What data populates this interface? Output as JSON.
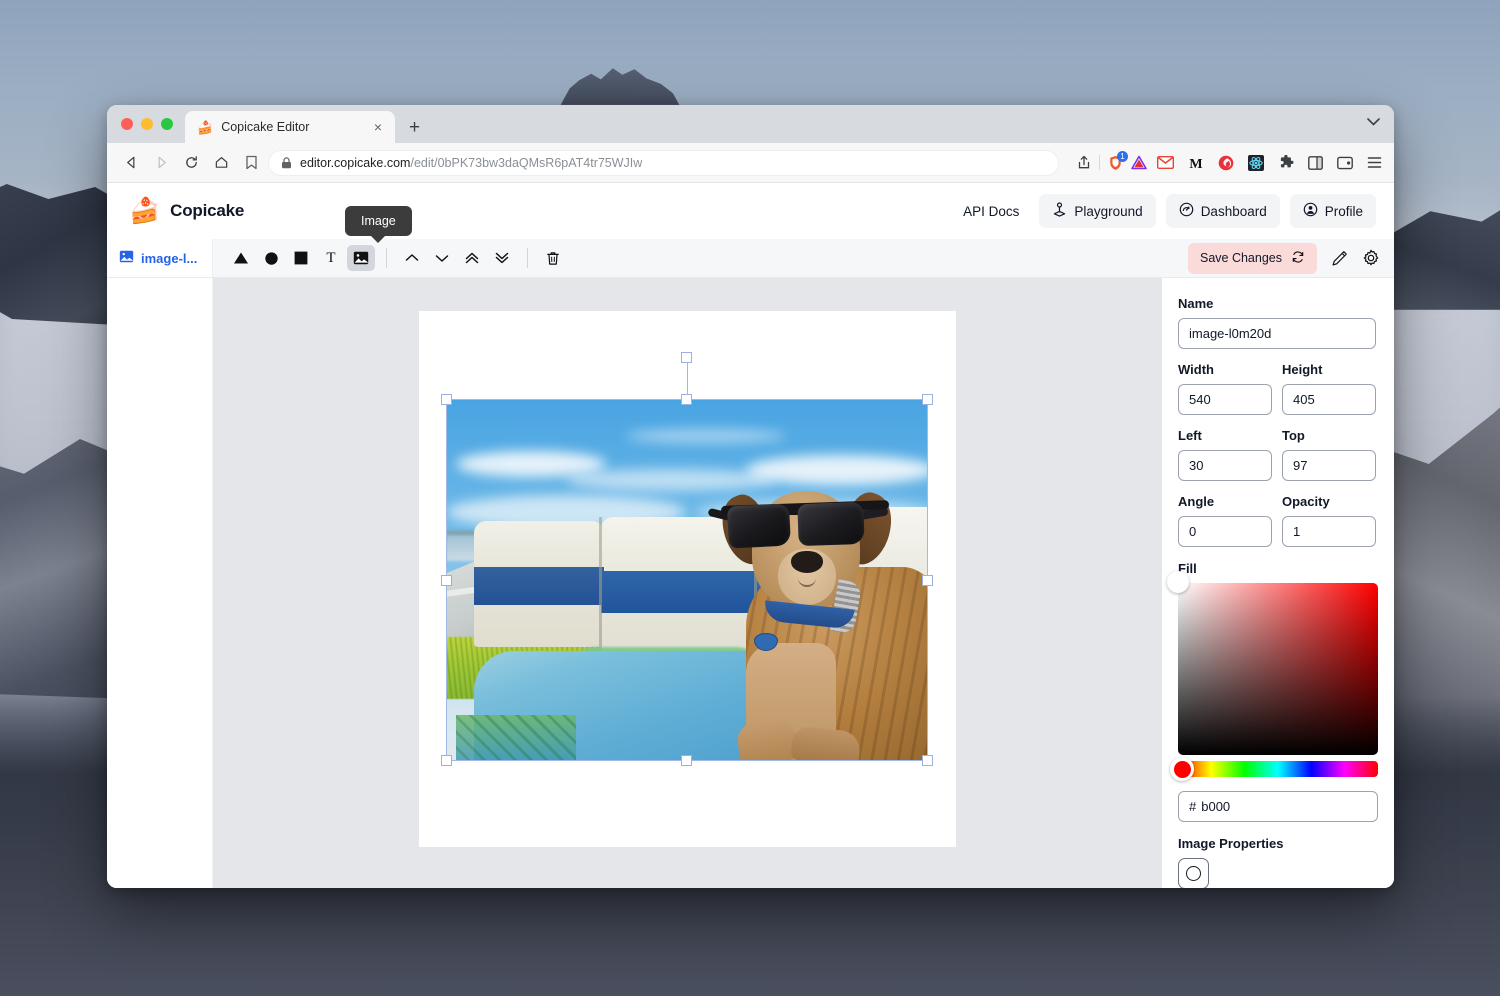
{
  "browser": {
    "tab": {
      "title": "Copicake Editor",
      "favicon": "cake-icon",
      "close": "×"
    },
    "new_tab_label": "+",
    "tab_list_chevron": "⌄",
    "url_domain": "editor.copicake.com",
    "url_path": "/edit/0bPK73bw3daQMsR6pAT4tr75WJIw",
    "shield_badge": "1",
    "icons": {
      "back": "back-icon",
      "forward": "forward-icon",
      "reload": "reload-icon",
      "home": "home-icon",
      "bookmark": "bookmark-icon",
      "lock": "lock-icon",
      "share": "share-icon",
      "shield": "brave-shield-icon",
      "vercel": "vercel-icon",
      "gmail": "gmail-icon",
      "medium": "medium-icon",
      "flame": "flame-icon",
      "react": "react-icon",
      "puzzle": "extensions-icon",
      "sidebar": "sidebar-icon",
      "wallet": "wallet-icon",
      "menu": "menu-icon"
    }
  },
  "app": {
    "brand": "Copicake",
    "brand_logo": "cake-slice-icon",
    "nav": [
      {
        "label": "API Docs",
        "icon": ""
      },
      {
        "label": "Playground",
        "icon": "joystick-icon"
      },
      {
        "label": "Dashboard",
        "icon": "gauge-icon"
      },
      {
        "label": "Profile",
        "icon": "person-icon"
      }
    ],
    "tooltip": "Image",
    "layer": {
      "label": "image-l...",
      "icon": "image-icon"
    },
    "toolbar": {
      "tools": [
        {
          "name": "triangle-tool",
          "glyph": "▲",
          "active": false
        },
        {
          "name": "circle-tool",
          "glyph": "●",
          "active": false
        },
        {
          "name": "square-tool",
          "glyph": "■",
          "active": false
        },
        {
          "name": "text-tool",
          "glyph": "T",
          "active": false
        },
        {
          "name": "image-tool",
          "glyph": "image",
          "active": true
        }
      ],
      "arrange": [
        {
          "name": "bring-forward",
          "glyph": "⌃"
        },
        {
          "name": "send-backward",
          "glyph": "⌄"
        },
        {
          "name": "bring-to-front",
          "glyph": "«"
        },
        {
          "name": "send-to-back",
          "glyph": "»"
        }
      ],
      "delete": "trash-icon",
      "save_label": "Save Changes",
      "save_icon": "sync-icon",
      "pen_icon": "pen-icon",
      "settings_icon": "gear-icon"
    },
    "properties": {
      "name_label": "Name",
      "name_value": "image-l0m20d",
      "width_label": "Width",
      "width_value": "540",
      "height_label": "Height",
      "height_value": "405",
      "left_label": "Left",
      "left_value": "30",
      "top_label": "Top",
      "top_value": "97",
      "angle_label": "Angle",
      "angle_value": "0",
      "opacity_label": "Opacity",
      "opacity_value": "1",
      "fill_label": "Fill",
      "hex_prefix": "#",
      "hex_value": "b000",
      "image_properties_label": "Image Properties",
      "image_properties_button": "circle-crop-icon"
    },
    "colors": {
      "save_bg": "#fbdada",
      "layer_text": "#2563eb",
      "picker_hue": "#ff0000",
      "selection_handle": "#9bb0e3"
    }
  },
  "canvas": {
    "artboard_bg": "#ffffff",
    "workspace_bg": "#e4e6ea",
    "selected_object": "image-l0m20d",
    "image_alt": "brindle dog wearing black sunglasses lying on a blue towel on a boat"
  }
}
